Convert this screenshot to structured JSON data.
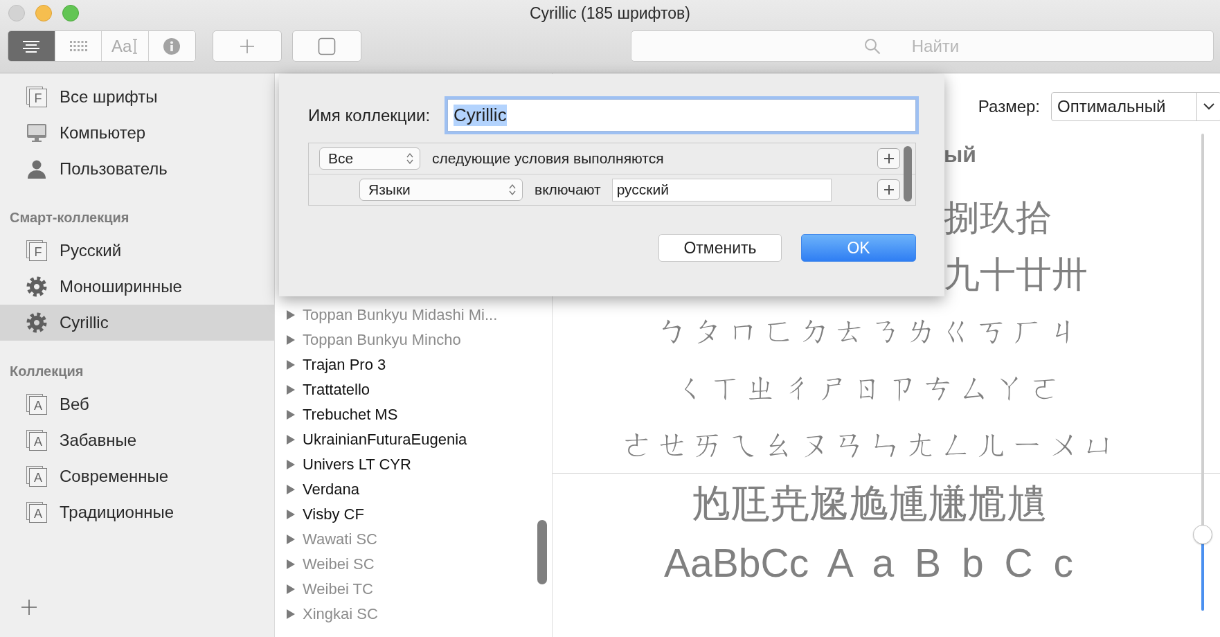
{
  "window": {
    "title": "Cyrillic (185 шрифтов)"
  },
  "toolbar": {
    "view_segments": [
      {
        "kind": "list",
        "selected": true
      },
      {
        "kind": "grid",
        "selected": false
      },
      {
        "kind": "sample",
        "label": "Aa",
        "selected": false
      },
      {
        "kind": "info",
        "selected": false
      }
    ],
    "search": {
      "placeholder": "Найти"
    }
  },
  "sidebar": {
    "groups": [
      {
        "items": [
          {
            "label": "Все шрифты",
            "kind": "fonts",
            "badge": "F",
            "selected": false
          },
          {
            "label": "Компьютер",
            "kind": "computer",
            "selected": false
          },
          {
            "label": "Пользователь",
            "kind": "user",
            "selected": false
          }
        ]
      },
      {
        "header": "Смарт-коллекция",
        "items": [
          {
            "label": "Русский",
            "kind": "fonts",
            "badge": "F",
            "selected": false
          },
          {
            "label": "Моноширинные",
            "kind": "smart",
            "selected": false
          },
          {
            "label": "Cyrillic",
            "kind": "smart",
            "selected": true
          }
        ]
      },
      {
        "header": "Коллекция",
        "items": [
          {
            "label": "Веб",
            "kind": "collection",
            "badge": "A",
            "selected": false
          },
          {
            "label": "Забавные",
            "kind": "collection",
            "badge": "A",
            "selected": false
          },
          {
            "label": "Современные",
            "kind": "collection",
            "badge": "A",
            "selected": false
          },
          {
            "label": "Традиционные",
            "kind": "collection",
            "badge": "A",
            "selected": false
          }
        ]
      }
    ]
  },
  "font_list": {
    "rows": [
      {
        "name": "Toppan Bunkyu Midashi Mi...",
        "installed": false
      },
      {
        "name": "Toppan Bunkyu Mincho",
        "installed": false
      },
      {
        "name": "Trajan Pro 3",
        "installed": true
      },
      {
        "name": "Trattatello",
        "installed": true
      },
      {
        "name": "Trebuchet MS",
        "installed": true
      },
      {
        "name": "UkrainianFuturaEugenia",
        "installed": true
      },
      {
        "name": "Univers LT CYR",
        "installed": true
      },
      {
        "name": "Verdana",
        "installed": true
      },
      {
        "name": "Visby CF",
        "installed": true
      },
      {
        "name": "Wawati SC",
        "installed": false
      },
      {
        "name": "Weibei SC",
        "installed": false
      },
      {
        "name": "Weibei TC",
        "installed": false
      },
      {
        "name": "Xingkai SC",
        "installed": false
      }
    ]
  },
  "preview": {
    "size_label": "Размер:",
    "size_value": "Оптимальный",
    "heading_fragment": "ый",
    "partial_lines": [
      "捌玖拾",
      "九十廿卅"
    ],
    "lines": [
      "ㄅ ㄆ ㄇ ㄈ ㄉ ㄊ ㄋ ㄌ ㄍ ㄎ ㄏ ㄐ",
      "ㄑ ㄒ ㄓ ㄔ ㄕ ㄖ ㄗ ㄘ ㄙ ㄚ ㄛ",
      "ㄜ ㄝ ㄞ ㄟ ㄠ ㄡ ㄢ ㄣ ㄤ ㄥ ㄦ ㄧ ㄨ ㄩ"
    ],
    "sample_lines": [
      "尥尫尭尮尯尰尲尳尵",
      "AaBbCc A a B b C c"
    ],
    "size_slider": {
      "level": 0.16
    }
  },
  "dialog": {
    "name_label": "Имя коллекции:",
    "name_value": "Cyrillic",
    "name_text_selected": true,
    "rules": [
      {
        "kind": "match",
        "popup": "Все",
        "text": "следующие условия выполняются"
      },
      {
        "kind": "condition",
        "popup": "Языки",
        "operator": "включают",
        "value": "русский"
      }
    ],
    "buttons": [
      {
        "label": "Отменить",
        "default": false
      },
      {
        "label": "OK",
        "default": true
      }
    ]
  }
}
